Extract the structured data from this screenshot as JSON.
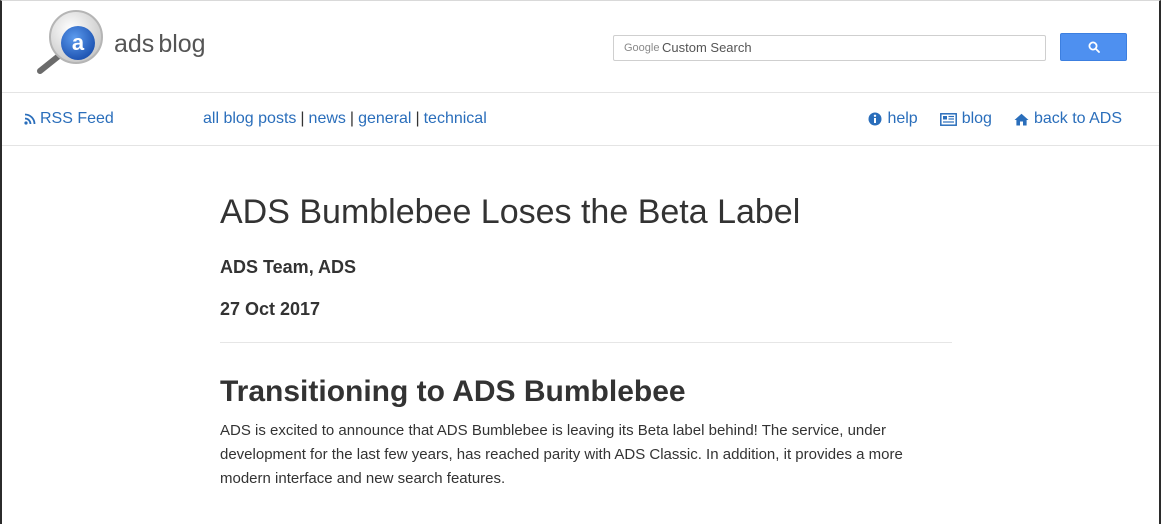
{
  "header": {
    "logo_letter": "a",
    "logo_ads": "ads",
    "logo_blog": "blog",
    "search": {
      "brand": "Google",
      "label": "Custom Search",
      "value": "",
      "button_icon": "search-icon"
    }
  },
  "nav": {
    "rss_label": "RSS Feed",
    "categories": [
      "all blog posts",
      "news",
      "general",
      "technical"
    ],
    "separator": "|",
    "right": [
      {
        "icon": "info-circle-icon",
        "label": "help"
      },
      {
        "icon": "newspaper-icon",
        "label": "blog"
      },
      {
        "icon": "home-icon",
        "label": "back to ADS"
      }
    ]
  },
  "article": {
    "title": "ADS Bumblebee Loses the Beta Label",
    "author": "ADS Team, ADS",
    "date": "27 Oct 2017",
    "section_heading": "Transitioning to ADS Bumblebee",
    "paragraph": "ADS is excited to announce that ADS Bumblebee is leaving its Beta label behind! The service, under development for the last few years, has reached parity with ADS Classic. In addition, it provides a more modern interface and new search features."
  },
  "colors": {
    "link": "#2a6ebb",
    "search_button": "#4e90f0",
    "logo_blue": "#2f6fd1",
    "text": "#333333"
  }
}
